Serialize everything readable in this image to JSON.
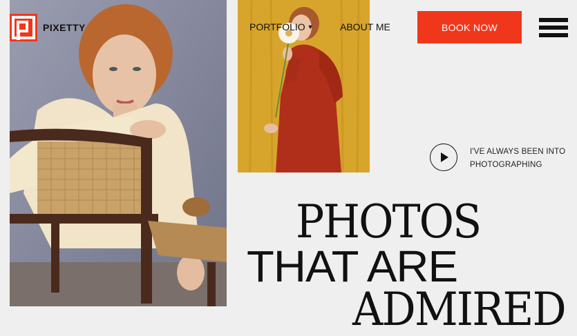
{
  "brand": {
    "name": "PIXETTY",
    "accent_color": "#f0371b"
  },
  "nav": {
    "items": [
      {
        "label": "PORTFOLIO",
        "has_dropdown": true
      },
      {
        "label": "ABOUT ME",
        "has_dropdown": false
      }
    ],
    "book_label": "BOOK NOW",
    "menu_icon": "hamburger-menu-icon"
  },
  "hero": {
    "tagline": "I'VE ALWAYS BEEN INTO PHOTOGRAPHING",
    "play_icon": "play-icon",
    "headline": [
      "PHOTOS",
      "THAT ARE",
      "ADMIRED"
    ],
    "images": [
      {
        "subject": "woman leaning on a cane chair"
      },
      {
        "subject": "woman in red dress holding a white flower"
      }
    ]
  }
}
